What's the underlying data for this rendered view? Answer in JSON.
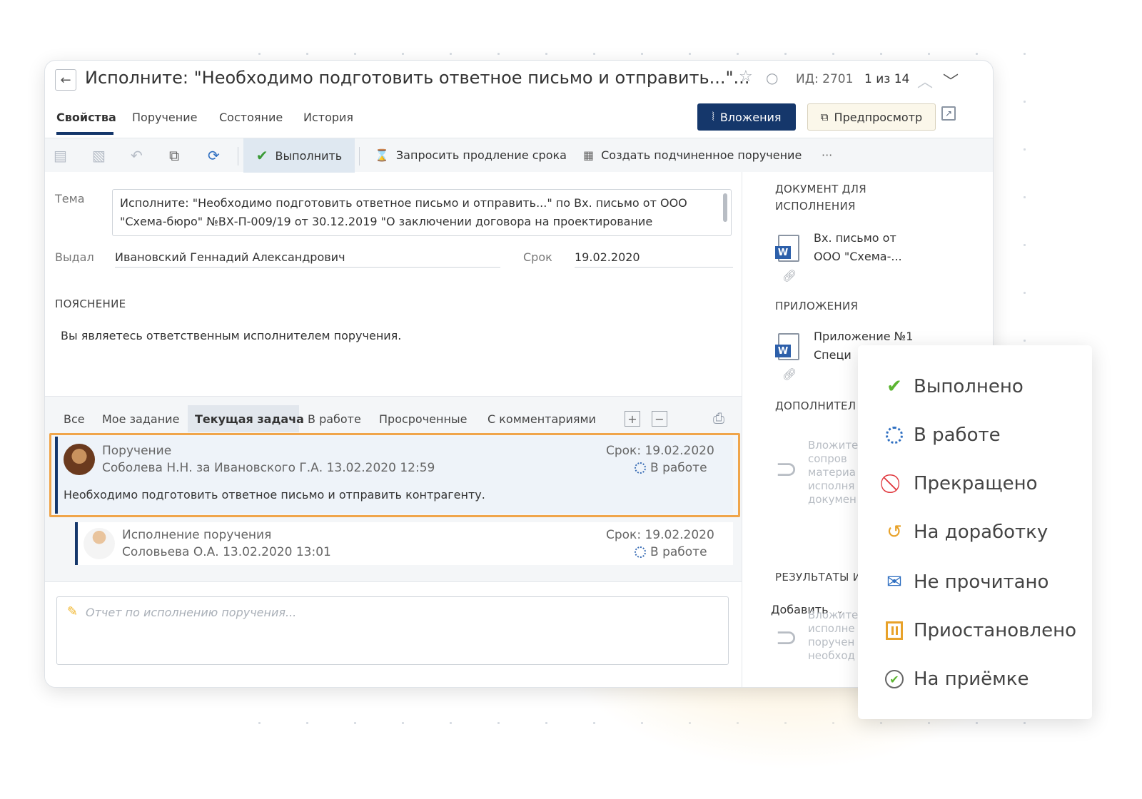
{
  "header": {
    "title": "Исполните: \"Необходимо подготовить ответное письмо и отправить...\"...",
    "id_text": "ИД: 2701",
    "count_text": "1 из 14"
  },
  "tabs": [
    {
      "label": "Свойства"
    },
    {
      "label": "Поручение"
    },
    {
      "label": "Состояние"
    },
    {
      "label": "История"
    }
  ],
  "buttons": {
    "attachments": "Вложения",
    "preview": "Предпросмотр"
  },
  "toolbar": {
    "execute": "Выполнить",
    "extend": "Запросить продление срока",
    "create_sub": "Создать подчиненное поручение",
    "more": "···"
  },
  "form": {
    "subject_label": "Тема",
    "subject_value": "Исполните: \"Необходимо подготовить ответное письмо и отправить...\" по Вх. письмо от ООО \"Схема-бюро\" №ВХ-П-009/19 от 30.12.2019 \"О заключении договора на проектирование",
    "issued_label": "Выдал",
    "issued_value": "Ивановский Геннадий Александрович",
    "deadline_label": "Срок",
    "deadline_value": "19.02.2020",
    "explanation_header": "ПОЯСНЕНИЕ",
    "explanation_text": "Вы являетесь ответственным исполнителем поручения."
  },
  "right_panel": {
    "doc_header_1": "ДОКУМЕНТ ДЛЯ",
    "doc_header_2": "ИСПОЛНЕНИЯ",
    "doc_line_1": "Вх. письмо от",
    "doc_line_2": "ООО \"Схема-...",
    "attachments_header": "ПРИЛОЖЕНИЯ",
    "att_line_1": "Приложение №1",
    "att_line_2": "Специ",
    "additional_header": "ДОПОЛНИТЕЛ",
    "additional_hint": [
      "Вложите",
      "сопров",
      "материа",
      "исполня",
      "докумен"
    ],
    "add_label": "Добавить",
    "results_header": "РЕЗУЛЬТАТЫ И",
    "results_hint": [
      "Вложите",
      "исполне",
      "поручен",
      "необход"
    ]
  },
  "filters": [
    {
      "label": "Все"
    },
    {
      "label": "Мое задание"
    },
    {
      "label": "Текущая задача"
    },
    {
      "label": "В работе"
    },
    {
      "label": "Просроченные"
    },
    {
      "label": "С комментариями"
    }
  ],
  "tasks": [
    {
      "type": "Поручение",
      "who": "Соболева Н.Н. за Ивановского Г.А.  13.02.2020 12:59",
      "due": "Срок: 19.02.2020",
      "status": "В работе",
      "text": "Необходимо подготовить ответное письмо и отправить контрагенту."
    },
    {
      "type": "Исполнение поручения",
      "who": "Соловьева О.А.  13.02.2020 13:01",
      "due": "Срок: 19.02.2020",
      "status": "В работе"
    }
  ],
  "comment": {
    "placeholder": "Отчет по исполнению поручения..."
  },
  "statuses": [
    {
      "label": "Выполнено",
      "icon": "check-icon",
      "color": "#5cb531"
    },
    {
      "label": "В работе",
      "icon": "in-progress-icon",
      "color": "#2f6fc1"
    },
    {
      "label": "Прекращено",
      "icon": "cancel-icon",
      "color": "#e0383e"
    },
    {
      "label": "На доработку",
      "icon": "rework-icon",
      "color": "#e8a22a"
    },
    {
      "label": "Не прочитано",
      "icon": "unread-mail-icon",
      "color": "#2f6fc1"
    },
    {
      "label": "Приостановлено",
      "icon": "pause-icon",
      "color": "#e8a22a"
    },
    {
      "label": "На приёмке",
      "icon": "accept-check-icon",
      "color": "#5cb531"
    }
  ],
  "colors": {
    "accent": "#15376b",
    "highlight": "#f0a54a"
  }
}
